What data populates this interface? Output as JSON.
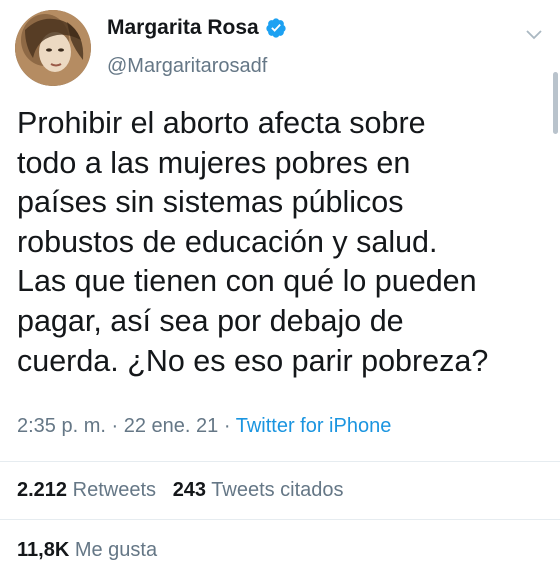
{
  "user": {
    "name": "Margarita Rosa",
    "handle": "@Margaritarosadf",
    "verified": true
  },
  "tweet": {
    "lines": [
      "Prohibir el aborto afecta sobre",
      "todo a las mujeres pobres en",
      "países sin sistemas públicos",
      "robustos de educación y salud.",
      "Las que tienen con qué lo pueden",
      "pagar, así sea por debajo de",
      "cuerda. ¿No es eso parir pobreza?"
    ],
    "time": "2:35 p. m.",
    "separator": "·",
    "date": "22 ene. 21",
    "source": "Twitter for iPhone"
  },
  "stats": {
    "retweets_count": "2.212",
    "retweets_label": "Retweets",
    "quotes_count": "243",
    "quotes_label": "Tweets citados",
    "likes_count": "11,8K",
    "likes_label": "Me gusta"
  },
  "colors": {
    "text": "#14171a",
    "secondary": "#657786",
    "link": "#1b95e0",
    "verified": "#1da1f2",
    "divider": "#e6ecf0"
  },
  "icons": {
    "verified": "verified-badge-icon",
    "menu": "chevron-down-icon"
  }
}
